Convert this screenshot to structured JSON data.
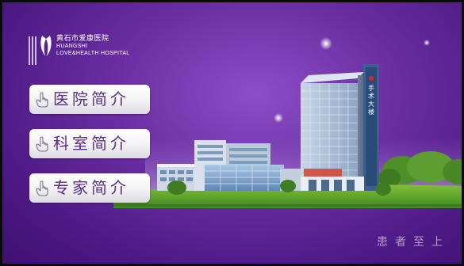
{
  "logo": {
    "chinese_name": "黄石市爱康医院",
    "english_line1": "HUANGSHI",
    "english_line2": "LOVE&HEALTH HOSPITAL"
  },
  "menu": {
    "items": [
      {
        "label": "医院简介"
      },
      {
        "label": "科室简介"
      },
      {
        "label": "专家简介"
      }
    ]
  },
  "building": {
    "tower_sign": "手术大楼"
  },
  "footer": {
    "slogan": "患者至上"
  },
  "colors": {
    "background": "#5a2294",
    "button_text": "#5b2d84",
    "slogan": "#b89ad0"
  }
}
